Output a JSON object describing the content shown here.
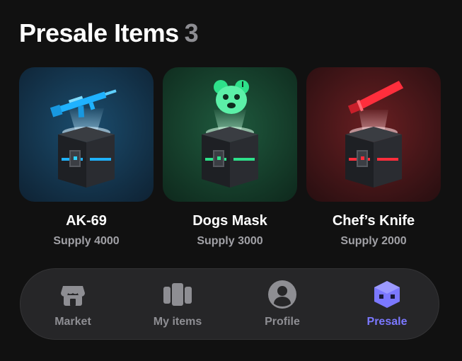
{
  "header": {
    "title": "Presale Items",
    "count": "3"
  },
  "items": [
    {
      "name": "AK-69",
      "supply": "Supply 4000",
      "icon": "rifle-icon",
      "color": "#1fb2ff"
    },
    {
      "name": "Dogs Mask",
      "supply": "Supply 3000",
      "icon": "dog-mask-icon",
      "color": "#2ee08a"
    },
    {
      "name": "Chef’s Knife",
      "supply": "Supply 2000",
      "icon": "knife-icon",
      "color": "#ff2e3c"
    }
  ],
  "tabs": [
    {
      "label": "Market",
      "icon": "store-icon",
      "active": false
    },
    {
      "label": "My items",
      "icon": "cards-icon",
      "active": false
    },
    {
      "label": "Profile",
      "icon": "person-icon",
      "active": false
    },
    {
      "label": "Presale",
      "icon": "cube-icon",
      "active": true
    }
  ],
  "colors": {
    "background": "#111111",
    "accent": "#7b78ff",
    "muted": "#8e8e93"
  }
}
